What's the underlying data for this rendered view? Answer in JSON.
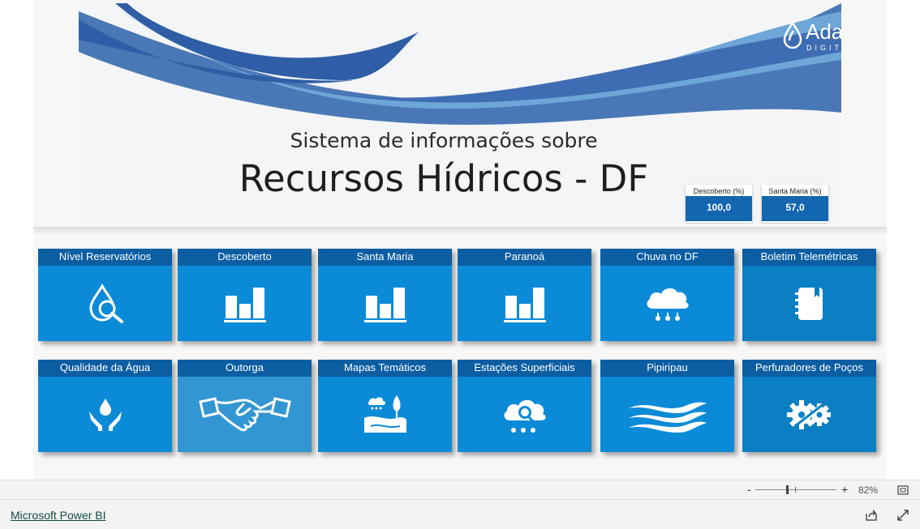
{
  "banner": {
    "subtitle": "Sistema de informações sobre",
    "title": "Recursos Hídricos - DF",
    "logo_name": "Adasa",
    "logo_sub": "DIGITAL"
  },
  "cards": [
    {
      "label": "Descoberto (%)",
      "value": "100,0"
    },
    {
      "label": "Santa Maria (%)",
      "value": "57,0"
    }
  ],
  "tiles": [
    {
      "label": "Nível Reservatórios",
      "icon": "water-search-icon"
    },
    {
      "label": "Descoberto",
      "icon": "bar-chart-icon"
    },
    {
      "label": "Santa Maria",
      "icon": "bar-chart-icon"
    },
    {
      "label": "Paranoá",
      "icon": "bar-chart-icon"
    },
    {
      "label": "Chuva no DF",
      "icon": "rain-cloud-icon"
    },
    {
      "label": "Boletim Telemétricas",
      "icon": "notebook-icon"
    },
    {
      "label": "Qualidade da Água",
      "icon": "hands-drop-icon"
    },
    {
      "label": "Outorga",
      "icon": "handshake-icon"
    },
    {
      "label": "Mapas Temáticos",
      "icon": "landscape-icon"
    },
    {
      "label": "Estações Superficiais",
      "icon": "cloud-search-icon"
    },
    {
      "label": "Pipiripau",
      "icon": "water-waves-icon"
    },
    {
      "label": "Perfuradores de Poços",
      "icon": "gear-wrench-icon"
    }
  ],
  "zoom": {
    "minus": "-",
    "plus": "+",
    "value": "82%",
    "level": 0.82
  },
  "footer": {
    "link": "Microsoft Power BI"
  },
  "colors": {
    "tile": "#0b8bd7",
    "tile_header": "#0c5ea3",
    "card_value": "#1367b1"
  }
}
